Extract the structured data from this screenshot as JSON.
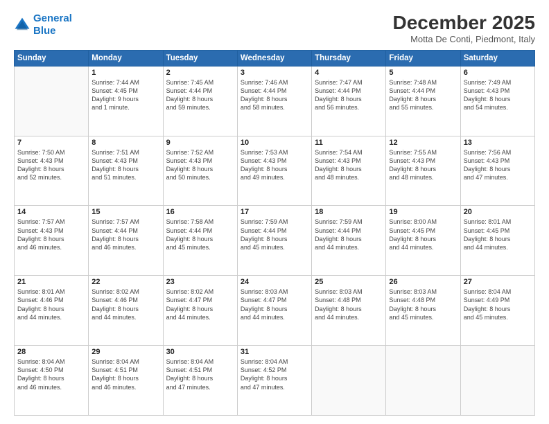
{
  "logo": {
    "line1": "General",
    "line2": "Blue"
  },
  "title": "December 2025",
  "subtitle": "Motta De Conti, Piedmont, Italy",
  "days_header": [
    "Sunday",
    "Monday",
    "Tuesday",
    "Wednesday",
    "Thursday",
    "Friday",
    "Saturday"
  ],
  "weeks": [
    [
      {
        "num": "",
        "info": ""
      },
      {
        "num": "1",
        "info": "Sunrise: 7:44 AM\nSunset: 4:45 PM\nDaylight: 9 hours\nand 1 minute."
      },
      {
        "num": "2",
        "info": "Sunrise: 7:45 AM\nSunset: 4:44 PM\nDaylight: 8 hours\nand 59 minutes."
      },
      {
        "num": "3",
        "info": "Sunrise: 7:46 AM\nSunset: 4:44 PM\nDaylight: 8 hours\nand 58 minutes."
      },
      {
        "num": "4",
        "info": "Sunrise: 7:47 AM\nSunset: 4:44 PM\nDaylight: 8 hours\nand 56 minutes."
      },
      {
        "num": "5",
        "info": "Sunrise: 7:48 AM\nSunset: 4:44 PM\nDaylight: 8 hours\nand 55 minutes."
      },
      {
        "num": "6",
        "info": "Sunrise: 7:49 AM\nSunset: 4:43 PM\nDaylight: 8 hours\nand 54 minutes."
      }
    ],
    [
      {
        "num": "7",
        "info": "Sunrise: 7:50 AM\nSunset: 4:43 PM\nDaylight: 8 hours\nand 52 minutes."
      },
      {
        "num": "8",
        "info": "Sunrise: 7:51 AM\nSunset: 4:43 PM\nDaylight: 8 hours\nand 51 minutes."
      },
      {
        "num": "9",
        "info": "Sunrise: 7:52 AM\nSunset: 4:43 PM\nDaylight: 8 hours\nand 50 minutes."
      },
      {
        "num": "10",
        "info": "Sunrise: 7:53 AM\nSunset: 4:43 PM\nDaylight: 8 hours\nand 49 minutes."
      },
      {
        "num": "11",
        "info": "Sunrise: 7:54 AM\nSunset: 4:43 PM\nDaylight: 8 hours\nand 48 minutes."
      },
      {
        "num": "12",
        "info": "Sunrise: 7:55 AM\nSunset: 4:43 PM\nDaylight: 8 hours\nand 48 minutes."
      },
      {
        "num": "13",
        "info": "Sunrise: 7:56 AM\nSunset: 4:43 PM\nDaylight: 8 hours\nand 47 minutes."
      }
    ],
    [
      {
        "num": "14",
        "info": "Sunrise: 7:57 AM\nSunset: 4:43 PM\nDaylight: 8 hours\nand 46 minutes."
      },
      {
        "num": "15",
        "info": "Sunrise: 7:57 AM\nSunset: 4:44 PM\nDaylight: 8 hours\nand 46 minutes."
      },
      {
        "num": "16",
        "info": "Sunrise: 7:58 AM\nSunset: 4:44 PM\nDaylight: 8 hours\nand 45 minutes."
      },
      {
        "num": "17",
        "info": "Sunrise: 7:59 AM\nSunset: 4:44 PM\nDaylight: 8 hours\nand 45 minutes."
      },
      {
        "num": "18",
        "info": "Sunrise: 7:59 AM\nSunset: 4:44 PM\nDaylight: 8 hours\nand 44 minutes."
      },
      {
        "num": "19",
        "info": "Sunrise: 8:00 AM\nSunset: 4:45 PM\nDaylight: 8 hours\nand 44 minutes."
      },
      {
        "num": "20",
        "info": "Sunrise: 8:01 AM\nSunset: 4:45 PM\nDaylight: 8 hours\nand 44 minutes."
      }
    ],
    [
      {
        "num": "21",
        "info": "Sunrise: 8:01 AM\nSunset: 4:46 PM\nDaylight: 8 hours\nand 44 minutes."
      },
      {
        "num": "22",
        "info": "Sunrise: 8:02 AM\nSunset: 4:46 PM\nDaylight: 8 hours\nand 44 minutes."
      },
      {
        "num": "23",
        "info": "Sunrise: 8:02 AM\nSunset: 4:47 PM\nDaylight: 8 hours\nand 44 minutes."
      },
      {
        "num": "24",
        "info": "Sunrise: 8:03 AM\nSunset: 4:47 PM\nDaylight: 8 hours\nand 44 minutes."
      },
      {
        "num": "25",
        "info": "Sunrise: 8:03 AM\nSunset: 4:48 PM\nDaylight: 8 hours\nand 44 minutes."
      },
      {
        "num": "26",
        "info": "Sunrise: 8:03 AM\nSunset: 4:48 PM\nDaylight: 8 hours\nand 45 minutes."
      },
      {
        "num": "27",
        "info": "Sunrise: 8:04 AM\nSunset: 4:49 PM\nDaylight: 8 hours\nand 45 minutes."
      }
    ],
    [
      {
        "num": "28",
        "info": "Sunrise: 8:04 AM\nSunset: 4:50 PM\nDaylight: 8 hours\nand 46 minutes."
      },
      {
        "num": "29",
        "info": "Sunrise: 8:04 AM\nSunset: 4:51 PM\nDaylight: 8 hours\nand 46 minutes."
      },
      {
        "num": "30",
        "info": "Sunrise: 8:04 AM\nSunset: 4:51 PM\nDaylight: 8 hours\nand 47 minutes."
      },
      {
        "num": "31",
        "info": "Sunrise: 8:04 AM\nSunset: 4:52 PM\nDaylight: 8 hours\nand 47 minutes."
      },
      {
        "num": "",
        "info": ""
      },
      {
        "num": "",
        "info": ""
      },
      {
        "num": "",
        "info": ""
      }
    ]
  ]
}
